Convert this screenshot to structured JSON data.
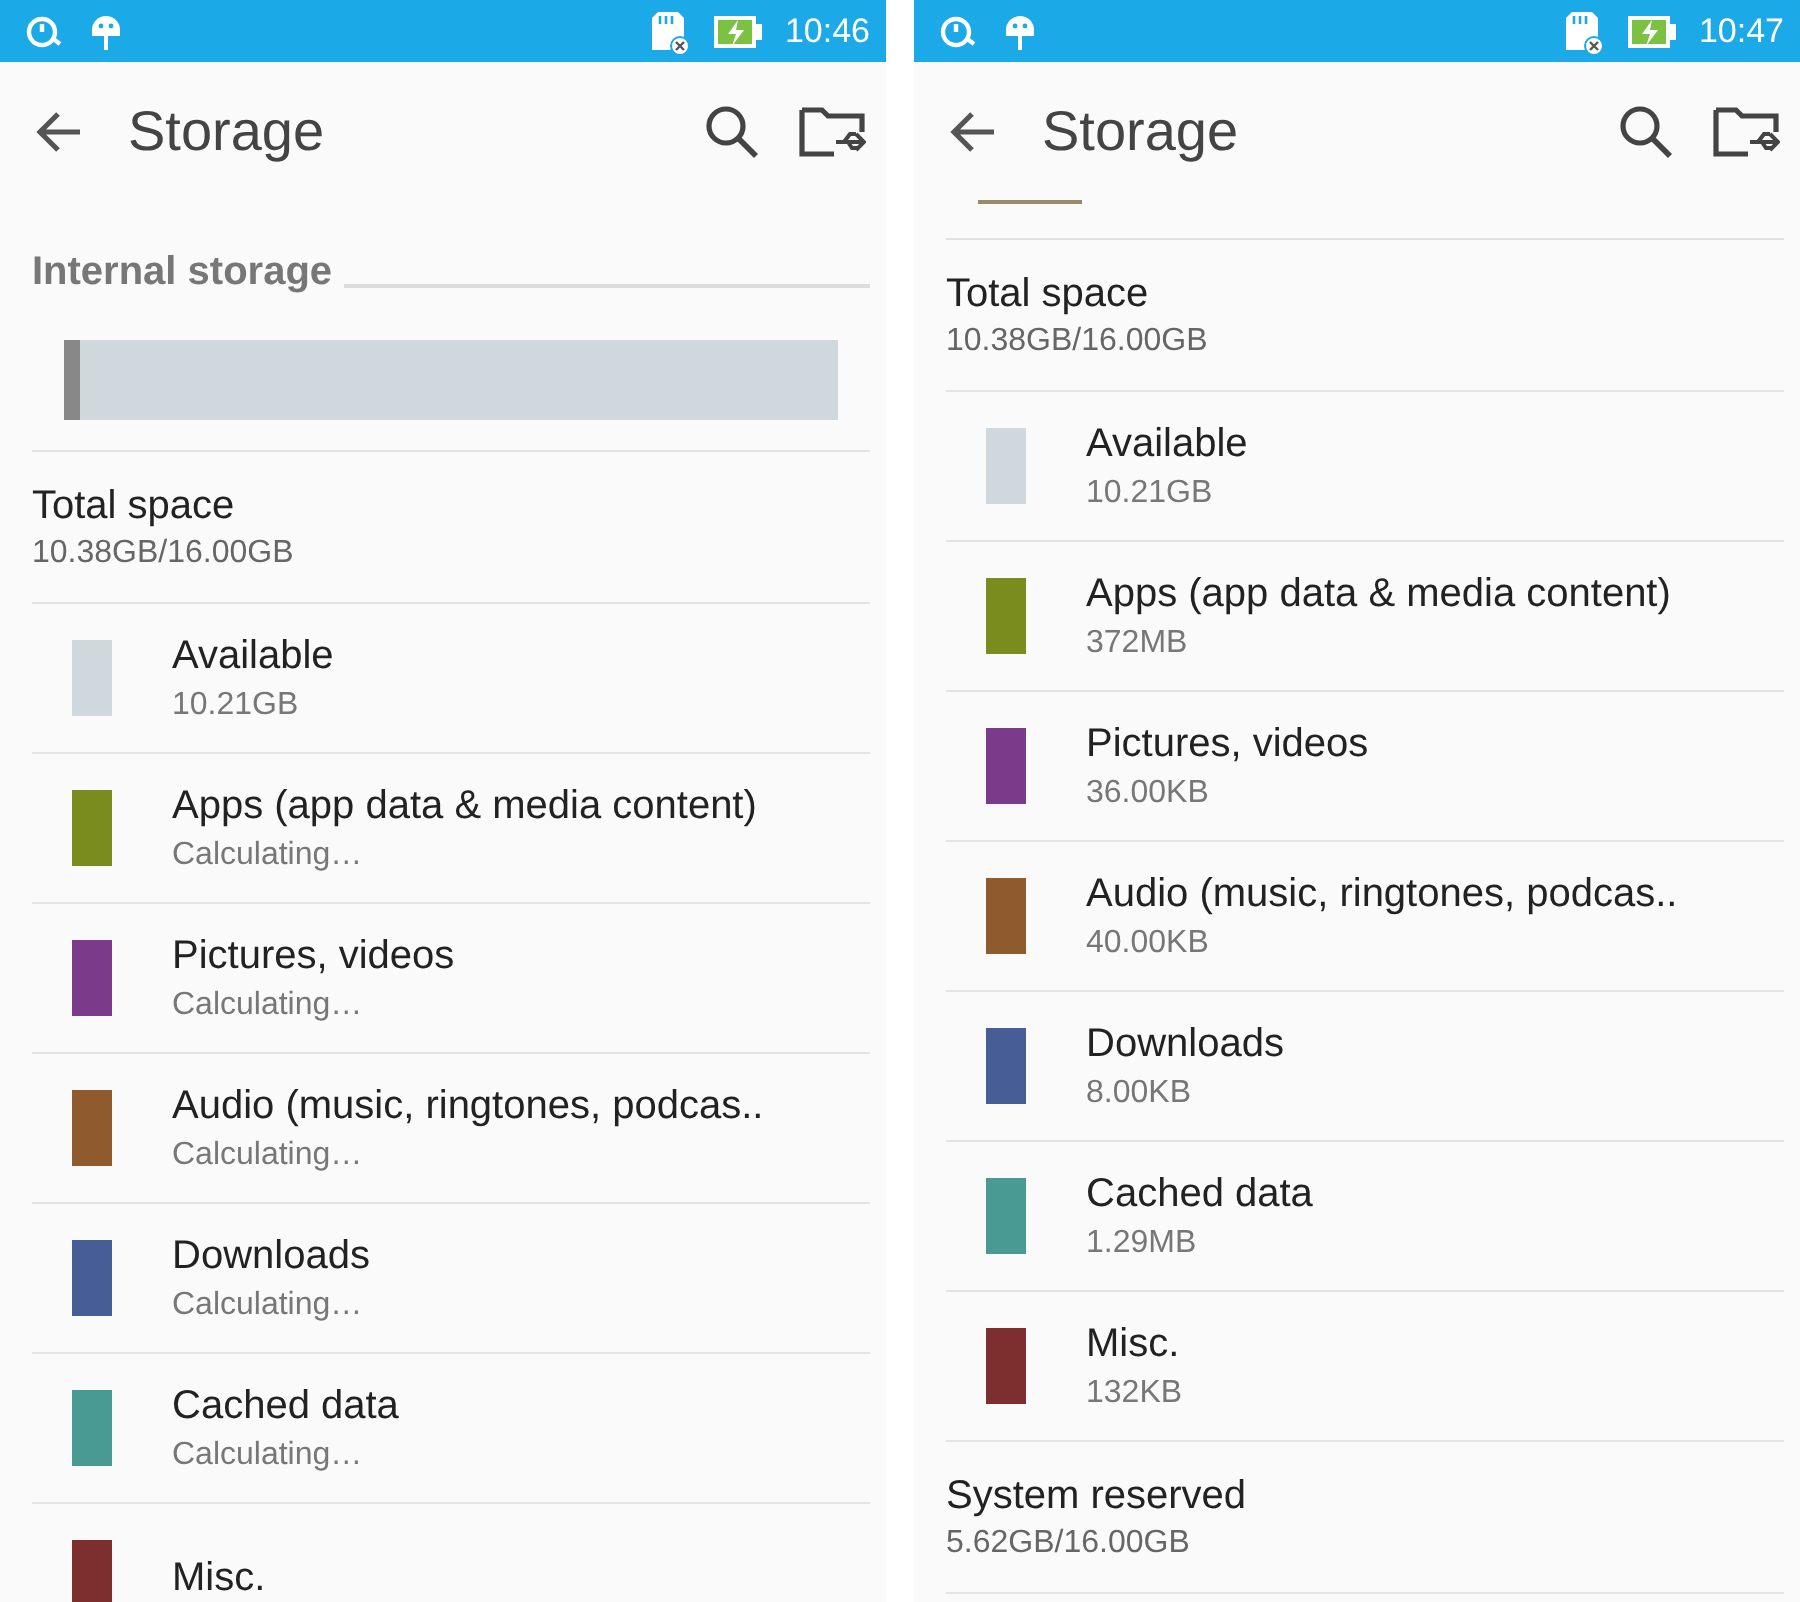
{
  "screens": [
    {
      "status_bar": {
        "time": "10:46"
      },
      "title": "Storage",
      "rows": [
        {
          "kind": "header",
          "label": "Internal storage"
        },
        {
          "kind": "bar",
          "level": 0.02
        },
        {
          "kind": "total",
          "label": "Total space",
          "value": "10.38GB/16.00GB"
        },
        {
          "kind": "category",
          "label": "Available",
          "value": "10.21GB",
          "color": "#cfd8dc"
        },
        {
          "kind": "category",
          "label": "Apps (app data & media content)",
          "value": "Calculating…",
          "color": "#7b8c1f"
        },
        {
          "kind": "category",
          "label": "Pictures, videos",
          "value": "Calculating…",
          "color": "#7b3b8a"
        },
        {
          "kind": "category",
          "label": "Audio (music, ringtones, podcas..",
          "value": "Calculating…",
          "color": "#8f5a2e"
        },
        {
          "kind": "category",
          "label": "Downloads",
          "value": "Calculating…",
          "color": "#465d95"
        },
        {
          "kind": "category",
          "label": "Cached data",
          "value": "Calculating…",
          "color": "#4a9a94"
        },
        {
          "kind": "category",
          "label": "Misc.",
          "color": "#7d2e2e"
        }
      ]
    },
    {
      "status_bar": {
        "time": "10:47"
      },
      "title": "Storage",
      "rows": [
        {
          "kind": "bar-edge"
        },
        {
          "kind": "total",
          "label": "Total space",
          "value": "10.38GB/16.00GB"
        },
        {
          "kind": "category",
          "label": "Available",
          "value": "10.21GB",
          "color": "#cfd8dc"
        },
        {
          "kind": "category",
          "label": "Apps (app data & media content)",
          "value": "372MB",
          "color": "#7b8c1f"
        },
        {
          "kind": "category",
          "label": "Pictures, videos",
          "value": "36.00KB",
          "color": "#7b3b8a"
        },
        {
          "kind": "category",
          "label": "Audio (music, ringtones, podcas..",
          "value": "40.00KB",
          "color": "#8f5a2e"
        },
        {
          "kind": "category",
          "label": "Downloads",
          "value": "8.00KB",
          "color": "#465d95"
        },
        {
          "kind": "category",
          "label": "Cached data",
          "value": "1.29MB",
          "color": "#4a9a94"
        },
        {
          "kind": "category",
          "label": "Misc.",
          "value": "132KB",
          "color": "#7d2e2e"
        },
        {
          "kind": "total",
          "label": "System reserved",
          "value": "5.62GB/16.00GB"
        }
      ]
    }
  ]
}
